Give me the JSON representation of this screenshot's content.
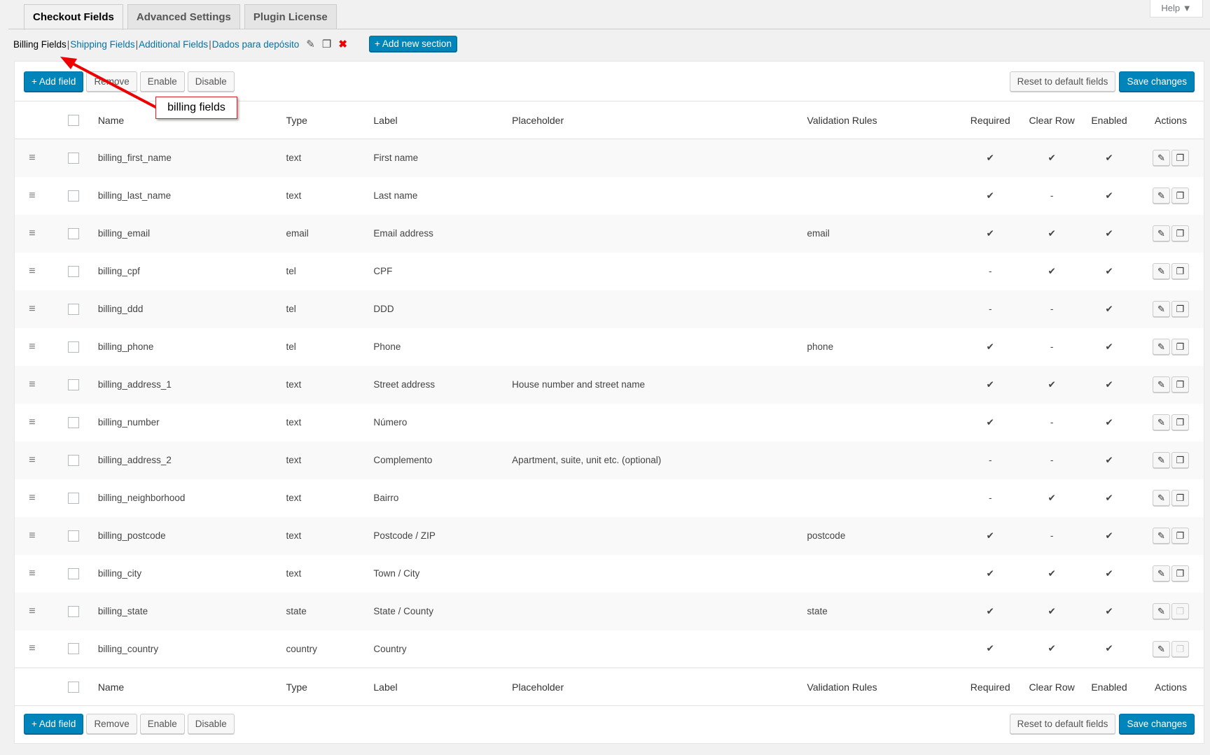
{
  "tabs": [
    "Checkout Fields",
    "Advanced Settings",
    "Plugin License"
  ],
  "help": "Help ▼",
  "sections": {
    "current": "Billing Fields",
    "links": [
      "Shipping Fields",
      "Additional Fields",
      "Dados para depósito"
    ],
    "add_section": "+ Add new section"
  },
  "toolbar": {
    "add": "+ Add field",
    "remove": "Remove",
    "enable": "Enable",
    "disable": "Disable",
    "reset": "Reset to default fields",
    "save": "Save changes"
  },
  "annotation": "billing fields",
  "columns": [
    "Name",
    "Type",
    "Label",
    "Placeholder",
    "Validation Rules",
    "Required",
    "Clear Row",
    "Enabled",
    "Actions"
  ],
  "rows": [
    {
      "name": "billing_first_name",
      "type": "text",
      "label": "First name",
      "placeholder": "",
      "validation": "",
      "required": true,
      "clear": true,
      "enabled": true,
      "copy": true
    },
    {
      "name": "billing_last_name",
      "type": "text",
      "label": "Last name",
      "placeholder": "",
      "validation": "",
      "required": true,
      "clear": false,
      "enabled": true,
      "copy": true
    },
    {
      "name": "billing_email",
      "type": "email",
      "label": "Email address",
      "placeholder": "",
      "validation": "email",
      "required": true,
      "clear": true,
      "enabled": true,
      "copy": true
    },
    {
      "name": "billing_cpf",
      "type": "tel",
      "label": "CPF",
      "placeholder": "",
      "validation": "",
      "required": false,
      "clear": true,
      "enabled": true,
      "copy": true
    },
    {
      "name": "billing_ddd",
      "type": "tel",
      "label": "DDD",
      "placeholder": "",
      "validation": "",
      "required": false,
      "clear": false,
      "enabled": true,
      "copy": true
    },
    {
      "name": "billing_phone",
      "type": "tel",
      "label": "Phone",
      "placeholder": "",
      "validation": "phone",
      "required": true,
      "clear": false,
      "enabled": true,
      "copy": true
    },
    {
      "name": "billing_address_1",
      "type": "text",
      "label": "Street address",
      "placeholder": "House number and street name",
      "validation": "",
      "required": true,
      "clear": true,
      "enabled": true,
      "copy": true
    },
    {
      "name": "billing_number",
      "type": "text",
      "label": "Número",
      "placeholder": "",
      "validation": "",
      "required": true,
      "clear": false,
      "enabled": true,
      "copy": true
    },
    {
      "name": "billing_address_2",
      "type": "text",
      "label": "Complemento",
      "placeholder": "Apartment, suite, unit etc. (optional)",
      "validation": "",
      "required": false,
      "clear": false,
      "enabled": true,
      "copy": true
    },
    {
      "name": "billing_neighborhood",
      "type": "text",
      "label": "Bairro",
      "placeholder": "",
      "validation": "",
      "required": false,
      "clear": true,
      "enabled": true,
      "copy": true
    },
    {
      "name": "billing_postcode",
      "type": "text",
      "label": "Postcode / ZIP",
      "placeholder": "",
      "validation": "postcode",
      "required": true,
      "clear": false,
      "enabled": true,
      "copy": true
    },
    {
      "name": "billing_city",
      "type": "text",
      "label": "Town / City",
      "placeholder": "",
      "validation": "",
      "required": true,
      "clear": true,
      "enabled": true,
      "copy": true
    },
    {
      "name": "billing_state",
      "type": "state",
      "label": "State / County",
      "placeholder": "",
      "validation": "state",
      "required": true,
      "clear": true,
      "enabled": true,
      "copy": false
    },
    {
      "name": "billing_country",
      "type": "country",
      "label": "Country",
      "placeholder": "",
      "validation": "",
      "required": true,
      "clear": true,
      "enabled": true,
      "copy": false
    }
  ]
}
